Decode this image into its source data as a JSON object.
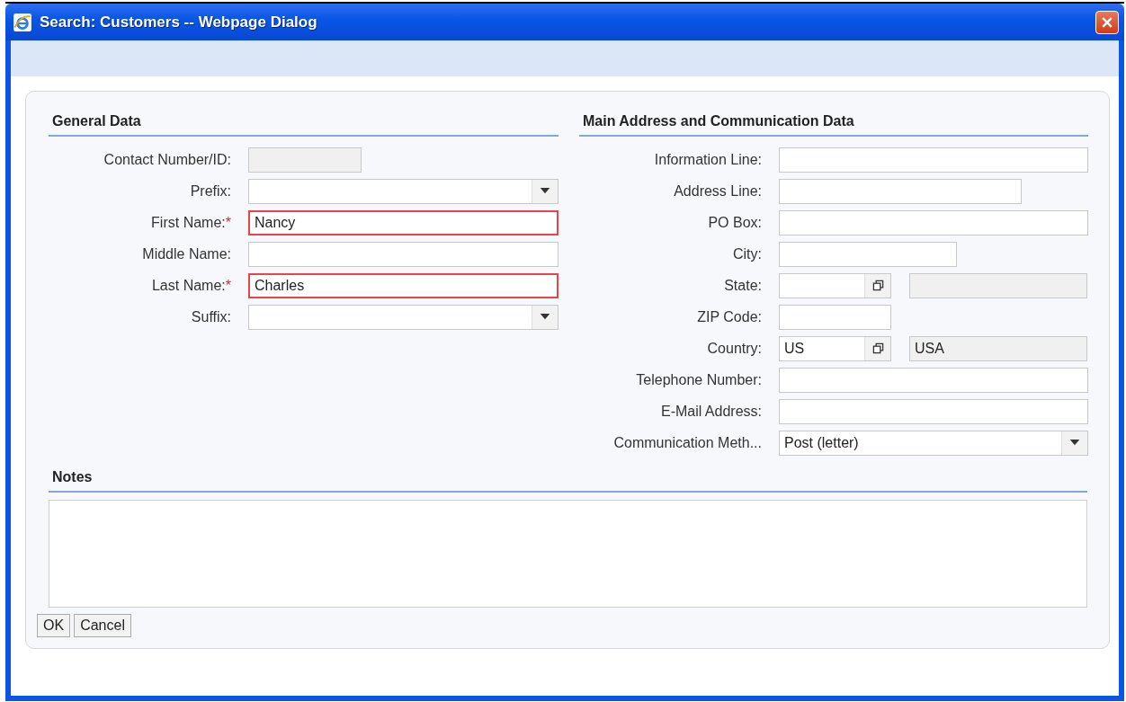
{
  "window": {
    "title": "Search: Customers -- Webpage Dialog"
  },
  "general_data": {
    "heading": "General Data",
    "fields": [
      {
        "label": "Contact Number/ID:",
        "kind": "text",
        "required": false,
        "disabled": true
      },
      {
        "label": "Prefix:",
        "kind": "select",
        "required": false,
        "disabled": false
      },
      {
        "label": "First Name:",
        "kind": "text",
        "required": true,
        "marker": "*",
        "disabled": false,
        "value": "Nancy"
      },
      {
        "label": "Middle Name:",
        "kind": "text",
        "required": false,
        "disabled": false
      },
      {
        "label": "Last Name:",
        "kind": "text",
        "required": true,
        "marker": "*",
        "disabled": false,
        "value": "Charles"
      },
      {
        "label": "Suffix:",
        "kind": "select",
        "required": false,
        "disabled": false
      }
    ]
  },
  "address_data": {
    "heading": "Main Address and Communication Data",
    "fields": [
      {
        "label": "Information Line:",
        "kind": "text",
        "required": false,
        "disabled": false
      },
      {
        "label": "Address Line:",
        "kind": "text",
        "required": false,
        "disabled": false
      },
      {
        "label": "PO Box:",
        "kind": "text",
        "required": false,
        "disabled": false
      },
      {
        "label": "City:",
        "kind": "text",
        "required": false,
        "disabled": false
      },
      {
        "label": "State:",
        "kind": "lookup",
        "required": false,
        "disabled": false
      },
      {
        "label": "ZIP Code:",
        "kind": "text",
        "required": false,
        "disabled": false
      },
      {
        "label": "Country:",
        "kind": "lookup",
        "required": false,
        "disabled": false,
        "value": "US",
        "description": "USA"
      },
      {
        "label": "Telephone Number:",
        "kind": "text",
        "required": false,
        "disabled": false
      },
      {
        "label": "E-Mail Address:",
        "kind": "text",
        "required": false,
        "disabled": false
      },
      {
        "label": "Communication Meth...",
        "kind": "select",
        "required": false,
        "disabled": false,
        "value": "Post (letter)"
      }
    ]
  },
  "notes": {
    "heading": "Notes"
  },
  "buttons": [
    "OK",
    "Cancel"
  ]
}
